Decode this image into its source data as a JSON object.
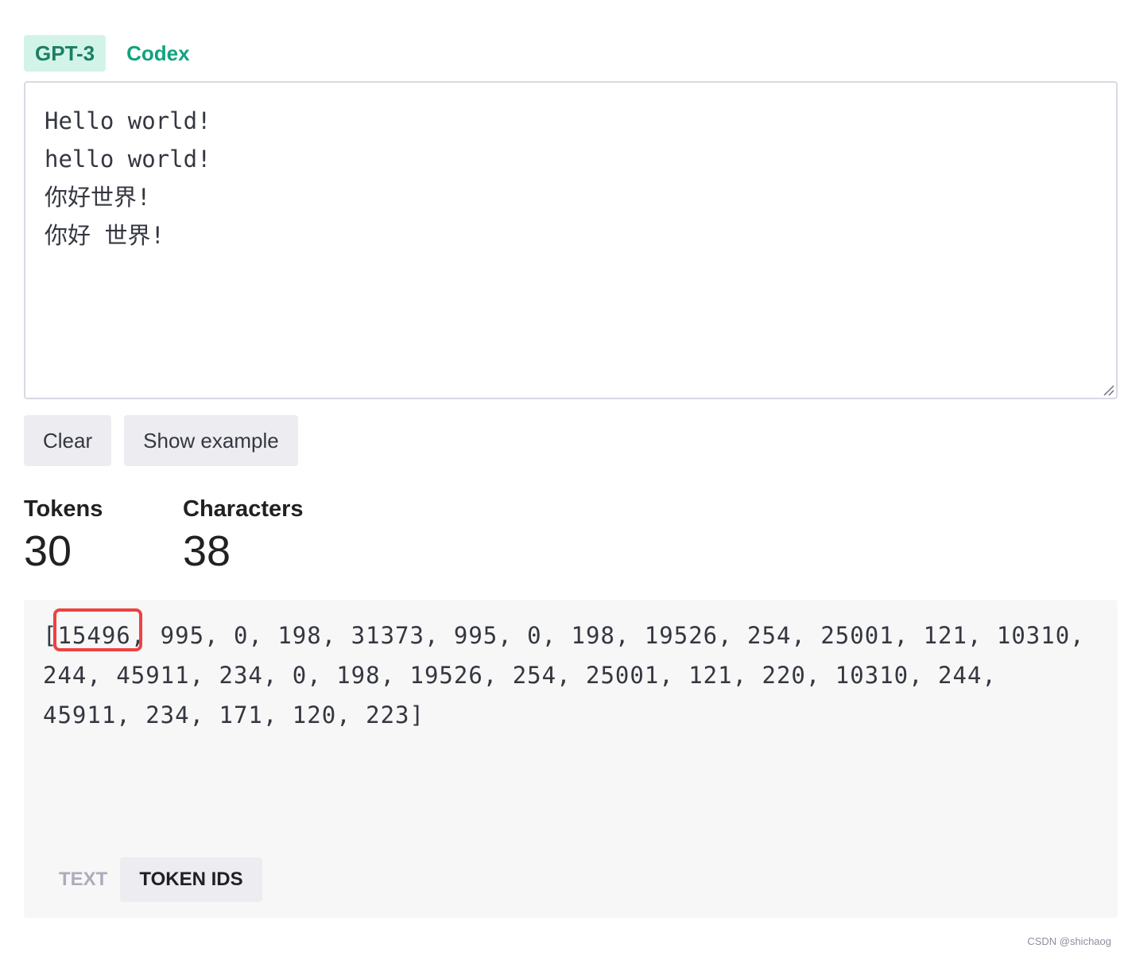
{
  "model_tabs": [
    {
      "label": "GPT-3",
      "active": true
    },
    {
      "label": "Codex",
      "active": false
    }
  ],
  "editor": {
    "value": "Hello world!\nhello world!\n你好世界!\n你好 世界!"
  },
  "buttons": {
    "clear_label": "Clear",
    "example_label": "Show example"
  },
  "stats": {
    "tokens_label": "Tokens",
    "tokens_value": "30",
    "characters_label": "Characters",
    "characters_value": "38"
  },
  "output": {
    "token_ids": "[15496, 995, 0, 198, 31373, 995, 0, 198, 19526, 254, 25001, 121, 10310, 244, 45911, 234, 0, 198, 19526, 254, 25001, 121, 220, 10310, 244, 45911, 234, 171, 120, 223]",
    "highlighted_token": "15496",
    "highlight_color": "#ef4141"
  },
  "view_tabs": [
    {
      "label": "TEXT",
      "active": false
    },
    {
      "label": "TOKEN IDS",
      "active": true
    }
  ],
  "watermark": "CSDN @shichaog",
  "colors": {
    "accent": "#10a37f",
    "active_tab_bg": "#d2f4e8",
    "button_bg": "#ececf1",
    "output_bg": "#f7f7f8"
  }
}
